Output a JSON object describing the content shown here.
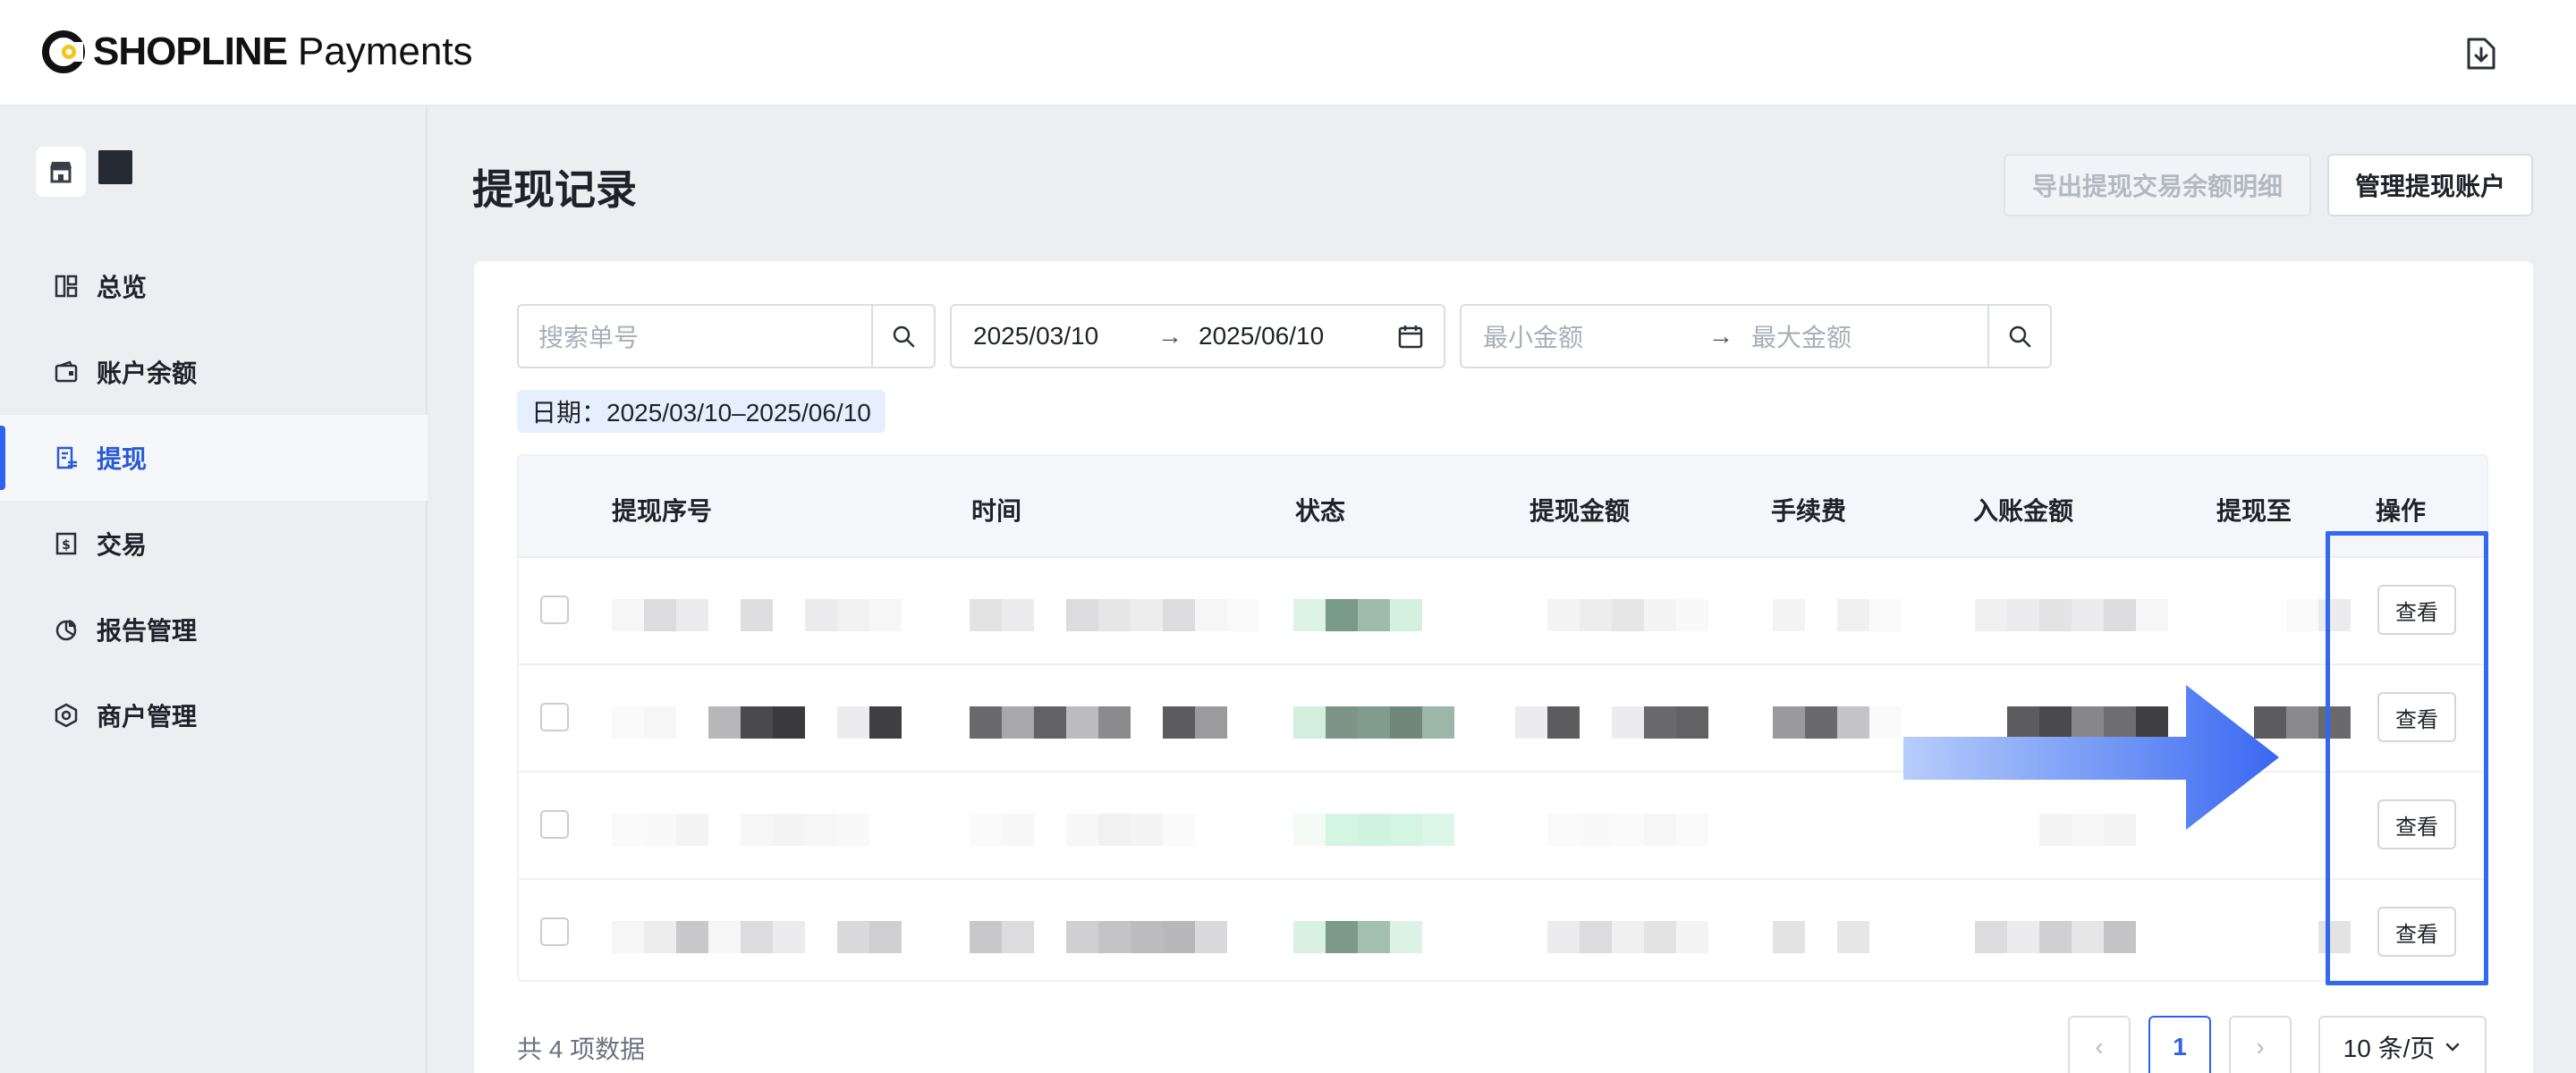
{
  "brand": {
    "name": "SHOPLINE",
    "product": "Payments",
    "accent": "#2f62f0",
    "logo_yellow": "#f5c518"
  },
  "header": {
    "download_icon": "download-icon"
  },
  "sidebar": {
    "items": [
      {
        "label": "总览",
        "icon": "dashboard-icon",
        "active": false
      },
      {
        "label": "账户余额",
        "icon": "wallet-icon",
        "active": false
      },
      {
        "label": "提现",
        "icon": "withdraw-icon",
        "active": true
      },
      {
        "label": "交易",
        "icon": "transaction-icon",
        "active": false
      },
      {
        "label": "报告管理",
        "icon": "report-icon",
        "active": false
      },
      {
        "label": "商户管理",
        "icon": "merchant-icon",
        "active": false
      }
    ]
  },
  "page": {
    "title": "提现记录",
    "export_button": "导出提现交易余额明细",
    "manage_button": "管理提现账户"
  },
  "filters": {
    "search_placeholder": "搜索单号",
    "date_start": "2025/03/10",
    "date_end": "2025/06/10",
    "range_arrow": "→",
    "amount_min_placeholder": "最小金额",
    "amount_max_placeholder": "最大金额",
    "active_tag": "日期：2025/03/10–2025/06/10"
  },
  "table": {
    "columns": [
      "提现序号",
      "时间",
      "状态",
      "提现金额",
      "手续费",
      "入账金额",
      "提现至",
      "操作"
    ],
    "rows": [
      {
        "action": "查看"
      },
      {
        "action": "查看"
      },
      {
        "action": "查看"
      },
      {
        "action": "查看"
      }
    ]
  },
  "pagination": {
    "total": "共 4 项数据",
    "prev": "‹",
    "current": "1",
    "next": "›",
    "page_size": "10 条/页"
  }
}
